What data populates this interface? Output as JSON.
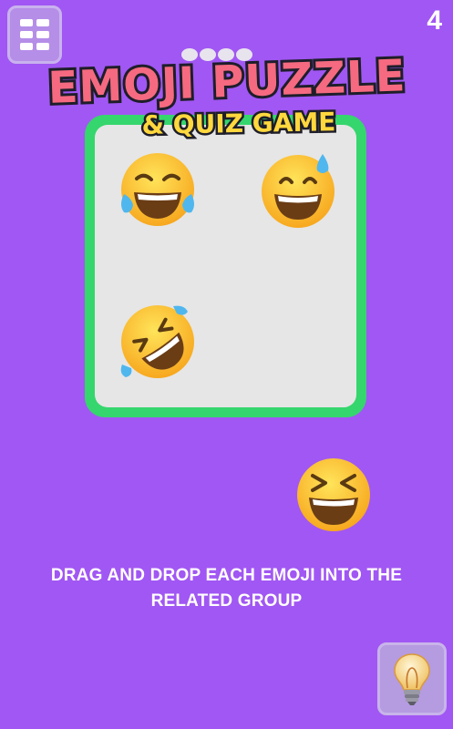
{
  "app": {
    "title_line1": "EMOJI PUZZLE",
    "title_line2": "& QUIZ GAME"
  },
  "header": {
    "menu_icon": "grid-menu-icon",
    "level_number": "4"
  },
  "board": {
    "border_color": "#35d66d",
    "background_color": "#e6e6e6",
    "emojis": [
      {
        "name": "face-with-tears-of-joy"
      },
      {
        "name": "grinning-face-with-sweat"
      },
      {
        "name": "rolling-on-the-floor-laughing"
      }
    ]
  },
  "draggable_emoji": {
    "name": "grinning-squinting-face"
  },
  "instruction": {
    "line1": "DRAG AND DROP EACH EMOJI INTO THE",
    "line2": "RELATED GROUP"
  },
  "hint": {
    "icon": "lightbulb-icon"
  },
  "colors": {
    "background": "#a157f3",
    "title_pink": "#f56a80",
    "title_yellow": "#ffd83d"
  }
}
